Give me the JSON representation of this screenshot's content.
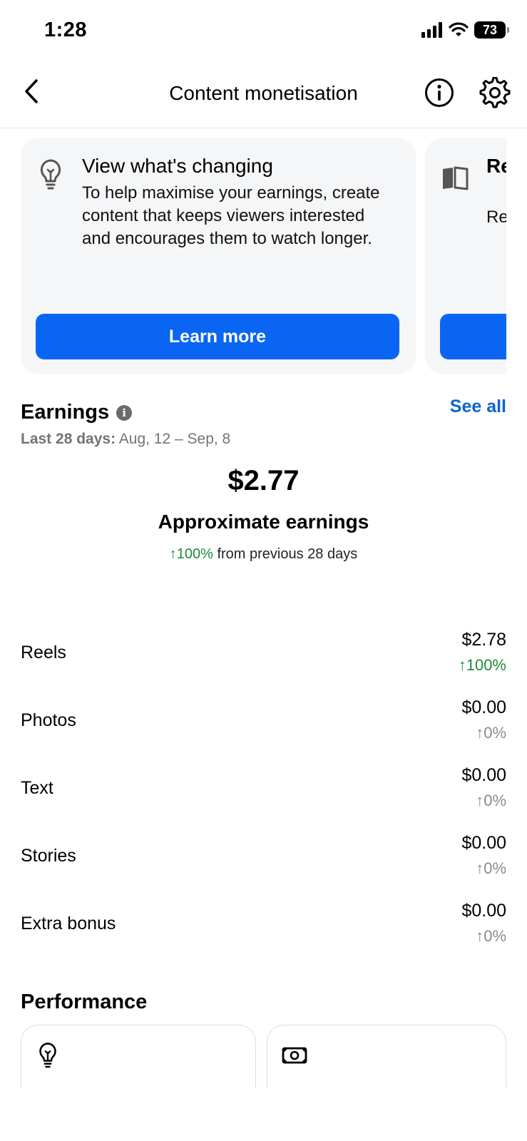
{
  "status_bar": {
    "time": "1:28",
    "battery": "73"
  },
  "nav": {
    "title": "Content monetisation",
    "back_icon": "chevron-left-icon",
    "info_icon": "info-icon",
    "settings_icon": "gear-icon"
  },
  "cards": [
    {
      "icon": "lightbulb-icon",
      "title": "View what's changing",
      "body": "To help maximise your earnings, create content that keeps viewers interested and encourages them to watch longer.",
      "button_label": "Learn more"
    },
    {
      "icon": "book-icon",
      "title": "Re up",
      "body": "Re isn to"
    }
  ],
  "earnings": {
    "title": "Earnings",
    "see_all": "See all",
    "range_label": "Last 28 days:",
    "range_value": "Aug, 12 – Sep, 8",
    "amount": "$2.77",
    "subtitle": "Approximate earnings",
    "change_value": "↑100%",
    "change_text": "from previous 28 days"
  },
  "breakdown": [
    {
      "label": "Reels",
      "value": "$2.78",
      "change": "↑100%",
      "positive": true
    },
    {
      "label": "Photos",
      "value": "$0.00",
      "change": "↑0%",
      "positive": false
    },
    {
      "label": "Text",
      "value": "$0.00",
      "change": "↑0%",
      "positive": false
    },
    {
      "label": "Stories",
      "value": "$0.00",
      "change": "↑0%",
      "positive": false
    },
    {
      "label": "Extra bonus",
      "value": "$0.00",
      "change": "↑0%",
      "positive": false
    }
  ],
  "performance": {
    "title": "Performance",
    "cards": [
      {
        "icon": "lightbulb-icon"
      },
      {
        "icon": "money-icon"
      }
    ]
  },
  "colors": {
    "accent": "#0a66f2",
    "link": "#0a66cc",
    "positive": "#1f8a3b",
    "card_bg": "#f5f6f8"
  }
}
